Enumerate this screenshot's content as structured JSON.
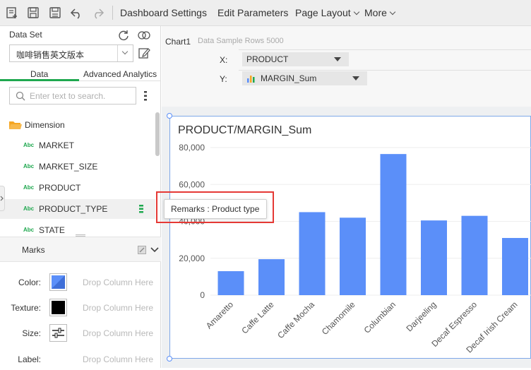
{
  "toolbar": {
    "menus": [
      "Dashboard Settings",
      "Edit Parameters",
      "Page Layout",
      "More"
    ],
    "icons": [
      "new-report-icon",
      "save-icon",
      "save-as-icon",
      "undo-icon",
      "redo-icon"
    ]
  },
  "left_panel": {
    "dataset_label": "Data Set",
    "dataset_value": "咖啡销售英文版本",
    "tabs": [
      "Data",
      "Advanced Analytics"
    ],
    "active_tab": "Data",
    "search_placeholder": "Enter text to search.",
    "dimension_label": "Dimension",
    "fields": [
      {
        "type": "Abc",
        "name": "MARKET"
      },
      {
        "type": "Abc",
        "name": "MARKET_SIZE"
      },
      {
        "type": "Abc",
        "name": "PRODUCT"
      },
      {
        "type": "Abc",
        "name": "PRODUCT_TYPE"
      },
      {
        "type": "Abc",
        "name": "STATE"
      }
    ],
    "marks": {
      "title": "Marks",
      "rows": [
        {
          "label": "Color:",
          "drop": "Drop Column Here"
        },
        {
          "label": "Texture:",
          "drop": "Drop Column Here"
        },
        {
          "label": "Size:",
          "drop": "Drop Column Here"
        },
        {
          "label": "Label:",
          "drop": "Drop Column Here"
        }
      ],
      "color_swatch": "#5b8ff9"
    }
  },
  "chart_header": {
    "chart_name": "Chart1",
    "sample_info": "Data Sample Rows 5000",
    "x_label": "X:",
    "x_value": "PRODUCT",
    "y_label": "Y:",
    "y_value": "MARGIN_Sum"
  },
  "tooltip": "Remarks : Product type",
  "colors": {
    "bar": "#5b8ff9",
    "accent": "#1fa84f",
    "highlight": "#e53935"
  },
  "chart_data": {
    "type": "bar",
    "title": "PRODUCT/MARGIN_Sum",
    "categories": [
      "Amaretto",
      "Caffe Latte",
      "Caffe Mocha",
      "Chamomile",
      "Columbian",
      "Darjeeling",
      "Decaf Espresso",
      "Decaf Irish Cream"
    ],
    "values": [
      13000,
      19500,
      45000,
      42000,
      76500,
      40500,
      43000,
      31000
    ],
    "ylim": [
      0,
      80000
    ],
    "yticks": [
      "0",
      "20,000",
      "40,000",
      "60,000",
      "80,000"
    ],
    "grid": true
  }
}
